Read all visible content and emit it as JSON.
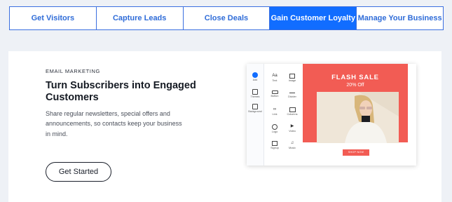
{
  "tabs": [
    {
      "label": "Get Visitors"
    },
    {
      "label": "Capture Leads"
    },
    {
      "label": "Close Deals"
    },
    {
      "label": "Gain Customer Loyalty",
      "active": true
    },
    {
      "label": "Manage Your Business"
    }
  ],
  "section": {
    "eyebrow": "EMAIL MARKETING",
    "headline": "Turn Subscribers into Engaged Customers",
    "description": "Share regular newsletters, special offers and announcements, so contacts keep your business in mind.",
    "cta_label": "Get Started"
  },
  "editor": {
    "rail": [
      "Add",
      "Themes",
      "Background"
    ],
    "elements": [
      "Text",
      "Image",
      "Button",
      "Divider",
      "Link",
      "Columns",
      "Logo",
      "Video",
      "Signup",
      "Music"
    ],
    "flash_title": "FLASH SALE",
    "flash_sub": "20% Off",
    "shop_label": "SHOP NOW"
  },
  "colors": {
    "accent": "#116dff",
    "sale": "#f25c54"
  }
}
